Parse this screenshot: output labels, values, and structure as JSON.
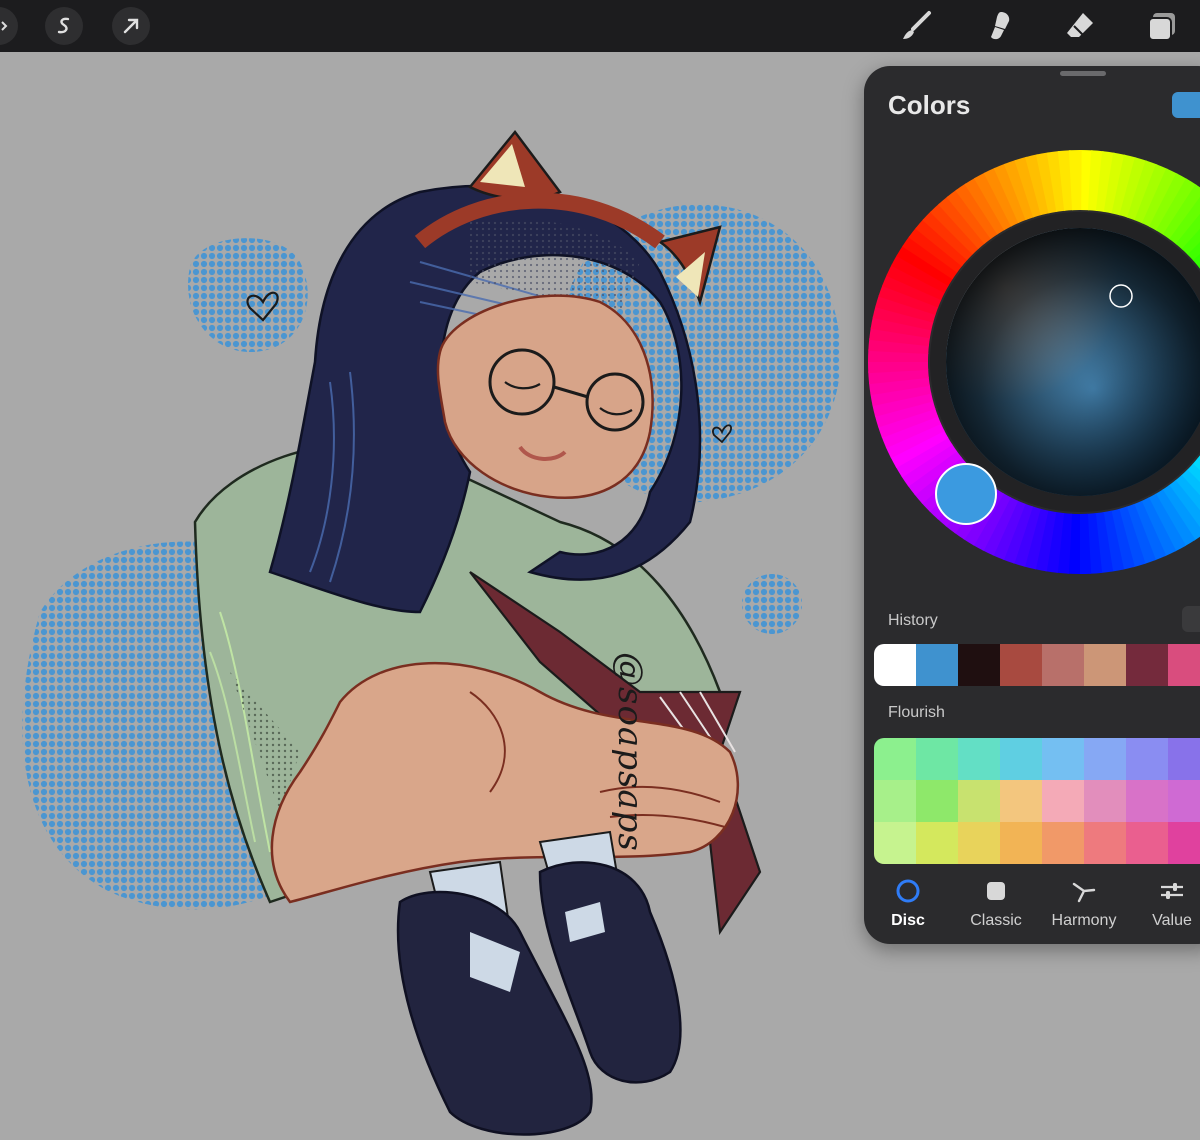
{
  "toolbar": {
    "left_tools": [
      "brush-dropdown-icon",
      "selection-icon",
      "transform-icon"
    ],
    "right_tools": [
      "brush-icon",
      "smudge-icon",
      "eraser-icon",
      "layers-icon"
    ]
  },
  "canvas": {
    "watermark": "@soapsaps",
    "background_color": "#a9a9a9",
    "dot_circle_color": "#4b96d1"
  },
  "colors_panel": {
    "title": "Colors",
    "current_color": "#3f92cf",
    "history_label": "History",
    "history": [
      "#ffffff",
      "#3f92cf",
      "#1f0f10",
      "#a84a40",
      "#b8706a",
      "#cc9677",
      "#742a3c",
      "#d94d7e"
    ],
    "palette_label": "Flourish",
    "palette": [
      [
        "#8cf08e",
        "#6ee7a4",
        "#63dfc5",
        "#5fcfe2",
        "#74bff2",
        "#86a8f4",
        "#8a8df2",
        "#8872ea"
      ],
      [
        "#a7f08a",
        "#8ee86a",
        "#c8e26f",
        "#f3c67e",
        "#f4aab7",
        "#e28ebc",
        "#d872c8",
        "#cf6ad3"
      ],
      [
        "#c6f38f",
        "#d4e85d",
        "#e8d35b",
        "#f2b455",
        "#f19968",
        "#ee7a7e",
        "#ea5f8f",
        "#e0419e"
      ]
    ],
    "modes": [
      {
        "label": "Disc",
        "icon": "disc-icon"
      },
      {
        "label": "Classic",
        "icon": "classic-square-icon"
      },
      {
        "label": "Harmony",
        "icon": "harmony-icon"
      },
      {
        "label": "Value",
        "icon": "sliders-icon"
      }
    ],
    "active_mode": "Disc"
  }
}
